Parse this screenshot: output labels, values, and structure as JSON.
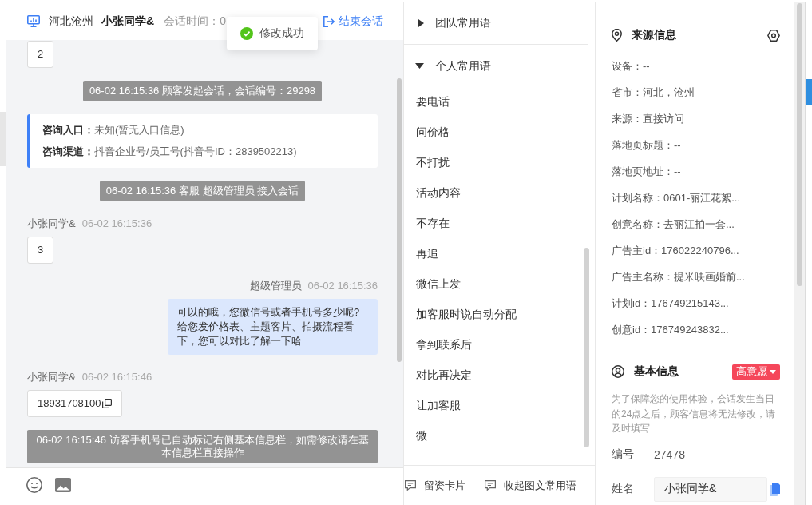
{
  "chat": {
    "header": {
      "location": "河北沧州",
      "customer": "小张同学&",
      "session_time": "会话时间：0",
      "end_button": "结束会话"
    },
    "toast": {
      "kind": "success",
      "text": "修改成功"
    },
    "messages": [
      {
        "kind": "visitor",
        "text": "2",
        "copyable": false
      },
      {
        "kind": "system",
        "text": "06-02 16:15:36 顾客发起会话，会话编号：29298"
      },
      {
        "kind": "entry_card",
        "lines": [
          {
            "label": "咨询入口：",
            "value": "未知(暂无入口信息)"
          },
          {
            "label": "咨询渠道：",
            "value": "抖音企业号/员工号(抖音号ID：2839502213)"
          }
        ]
      },
      {
        "kind": "system",
        "text": "06-02 16:15:36 客服 超级管理员 接入会话"
      },
      {
        "kind": "visitor",
        "sender": "小张同学&",
        "time": "06-02 16:15:36",
        "text": "3",
        "copyable": false
      },
      {
        "kind": "agent",
        "sender": "超级管理员",
        "time": "06-02 16:15:36",
        "text": "可以的哦，您微信号或者手机号多少呢?给您发价格表、主题客片、拍摄流程看下，您可以对比了解一下哈",
        "copyable": false
      },
      {
        "kind": "visitor",
        "sender": "小张同学&",
        "time": "06-02 16:15:46",
        "text": "18931708100",
        "copyable": true
      },
      {
        "kind": "system",
        "text": "06-02 16:15:46 访客手机号已自动标记右侧基本信息栏，如需修改请在基本信息栏直接操作"
      }
    ]
  },
  "phrases": {
    "groups": [
      {
        "title": "团队常用语",
        "expanded": false
      },
      {
        "title": "个人常用语",
        "expanded": true,
        "items": [
          "要电话",
          "问价格",
          "不打扰",
          "活动内容",
          "不存在",
          "再追",
          "微信上发",
          "加客服时说自动分配",
          "拿到联系后",
          "对比再决定",
          "让加客服",
          "微"
        ]
      }
    ],
    "actions": [
      "留资卡片",
      "收起图文常用语"
    ]
  },
  "source_info": {
    "title": "来源信息",
    "rows": [
      "设备：--",
      "省市：河北，沧州",
      "来源：直接访问",
      "落地页标题：--",
      "落地页地址：--",
      "计划名称：0601-丽江花絮...",
      "创意名称：去丽江拍一套...",
      "广告主id：176022240796...",
      "广告主名称：提米映画婚前...",
      "计划id：176749215143...",
      "创意id：176749243832..."
    ]
  },
  "basic_info": {
    "title": "基本信息",
    "intent_tag": "高意愿",
    "note": "为了保障您的使用体验，会话发生当日的24点之后，顾客信息将无法修改，请及时填写",
    "fields": [
      {
        "kind": "text",
        "label": "编号",
        "value": "27478"
      },
      {
        "kind": "input",
        "label": "姓名",
        "value": "小张同学&",
        "copyable": true
      }
    ]
  }
}
